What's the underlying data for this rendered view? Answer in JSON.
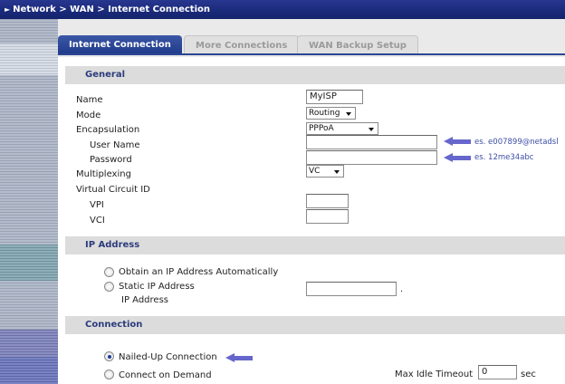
{
  "breadcrumb": "Network > WAN > Internet Connection",
  "tabs": {
    "internet_connection": "Internet Connection",
    "more_connections": "More Connections",
    "wan_backup_setup": "WAN Backup Setup"
  },
  "general": {
    "title": "General",
    "name_label": "Name",
    "name_value": "MyISP",
    "mode_label": "Mode",
    "mode_value": "Routing",
    "encapsulation_label": "Encapsulation",
    "encapsulation_value": "PPPoA",
    "user_name_label": "User Name",
    "user_name_value": "",
    "user_name_hint": "es. e007899@netadsl",
    "password_label": "Password",
    "password_value": "",
    "password_hint": "es. 12me34abc",
    "multiplexing_label": "Multiplexing",
    "multiplexing_value": "VC",
    "vcid_label": "Virtual Circuit ID",
    "vpi_label": "VPI",
    "vpi_value": "",
    "vci_label": "VCI",
    "vci_value": ""
  },
  "ip_address": {
    "title": "IP Address",
    "obtain_auto": "Obtain an IP Address Automatically",
    "static_ip": "Static IP Address",
    "ip_address_label": "IP Address",
    "ip_address_value": "",
    "separator": "."
  },
  "connection": {
    "title": "Connection",
    "nailed_up": "Nailed-Up Connection",
    "on_demand": "Connect on Demand",
    "max_idle_label": "Max Idle Timeout",
    "max_idle_value": "0",
    "max_idle_unit": "sec"
  },
  "colors": {
    "header": "#1a2a7a",
    "active_tab": "#2b4694",
    "section_bg": "#dcdcdc",
    "section_text": "#2c3c7c",
    "hint_text": "#3d4fa6",
    "arrow": "#6666cc"
  }
}
